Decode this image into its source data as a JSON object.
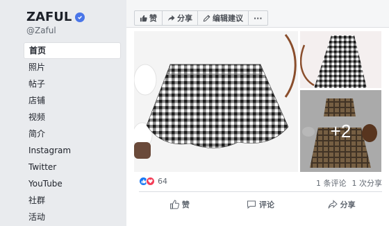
{
  "page": {
    "name": "ZAFUL",
    "handle": "@Zaful"
  },
  "sidebar": {
    "items": [
      {
        "label": "首页",
        "active": true
      },
      {
        "label": "照片"
      },
      {
        "label": "帖子"
      },
      {
        "label": "店铺"
      },
      {
        "label": "视频"
      },
      {
        "label": "简介"
      },
      {
        "label": "Instagram"
      },
      {
        "label": "Twitter"
      },
      {
        "label": "YouTube"
      },
      {
        "label": "社群"
      },
      {
        "label": "活动"
      }
    ]
  },
  "actions": {
    "like": "赞",
    "share": "分享",
    "suggest_edit": "编辑建议",
    "more": "···"
  },
  "photos": {
    "more_count": "+2"
  },
  "post": {
    "reaction_count": "64",
    "comments": "1 条评论",
    "shares": "1 次分享"
  },
  "footer": {
    "like": "赞",
    "comment": "评论",
    "share": "分享"
  },
  "colors": {
    "verified": "#4a76e8",
    "like_reaction": "#1877f2",
    "love_reaction": "#f33e58"
  },
  "icons": {
    "verified": "verified-badge-icon",
    "like": "thumbs-up-icon",
    "share": "share-arrow-icon",
    "edit": "pencil-icon",
    "comment": "comment-bubble-icon"
  }
}
